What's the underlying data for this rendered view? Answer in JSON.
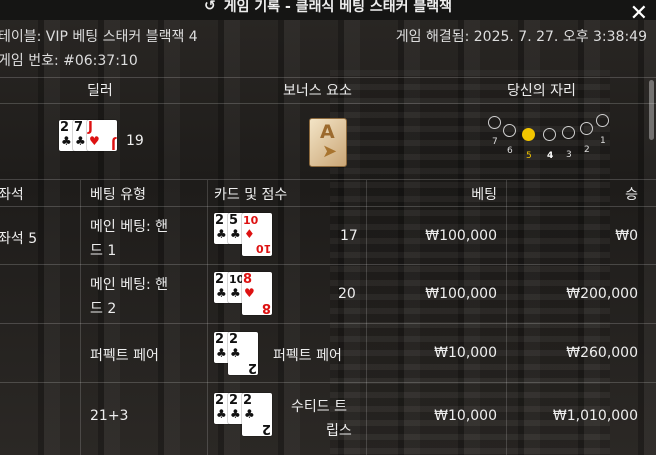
{
  "title": "게임 기록 - 클래식 베팅 스태커 블랙잭",
  "table_label": "테이블: VIP 베팅 스태커 블랙잭 4",
  "resolved_label": "게임 해결됨: 2025. 7. 27. 오후 3:38:49",
  "game_number": "게임 번호: #06:37:10",
  "dealer": {
    "label": "딜러",
    "score": "19",
    "cards": [
      {
        "rank": "2",
        "suit": "♣",
        "red": false
      },
      {
        "rank": "7",
        "suit": "♣",
        "red": false
      },
      {
        "rank": "J",
        "suit": "♥",
        "red": true
      }
    ]
  },
  "bonus": {
    "label": "보너스 요소",
    "card_rank": "A"
  },
  "seat": {
    "label": "당신의 자리",
    "numbers": [
      "7",
      "6",
      "5",
      "4",
      "3",
      "2",
      "1"
    ],
    "selected": "5"
  },
  "columns": {
    "seat": "좌석",
    "bet_type": "베팅 유형",
    "cards": "카드 및 점수",
    "bet": "베팅",
    "win": "승"
  },
  "rows": [
    {
      "seat": "좌석 5",
      "type_line1": "메인 베팅: 핸",
      "type_line2": "드 1",
      "score": "17",
      "bet": "₩100,000",
      "win": "₩0",
      "cards": [
        {
          "rank": "2",
          "suit": "♣",
          "red": false
        },
        {
          "rank": "5",
          "suit": "♣",
          "red": false
        },
        {
          "rank": "10",
          "suit": "♦",
          "red": true
        }
      ]
    },
    {
      "seat": "",
      "type_line1": "메인 베팅: 핸",
      "type_line2": "드 2",
      "score": "20",
      "bet": "₩100,000",
      "win": "₩200,000",
      "cards": [
        {
          "rank": "2",
          "suit": "♣",
          "red": false
        },
        {
          "rank": "10",
          "suit": "♣",
          "red": false
        },
        {
          "rank": "8",
          "suit": "♥",
          "red": true
        }
      ]
    },
    {
      "seat": "",
      "type_line1": "퍼펙트 페어",
      "type_line2": "",
      "score_line1": "퍼펙트 페어",
      "score_line2": "",
      "bet": "₩10,000",
      "win": "₩260,000",
      "cards": [
        {
          "rank": "2",
          "suit": "♣",
          "red": false
        },
        {
          "rank": "2",
          "suit": "♣",
          "red": false
        }
      ]
    },
    {
      "seat": "",
      "type_line1": "21+3",
      "type_line2": "",
      "score_line1": "수티드 트",
      "score_line2": "립스",
      "bet": "₩10,000",
      "win": "₩1,010,000",
      "cards": [
        {
          "rank": "2",
          "suit": "♣",
          "red": false
        },
        {
          "rank": "2",
          "suit": "♣",
          "red": false
        },
        {
          "rank": "2",
          "suit": "♣",
          "red": false
        }
      ]
    }
  ]
}
